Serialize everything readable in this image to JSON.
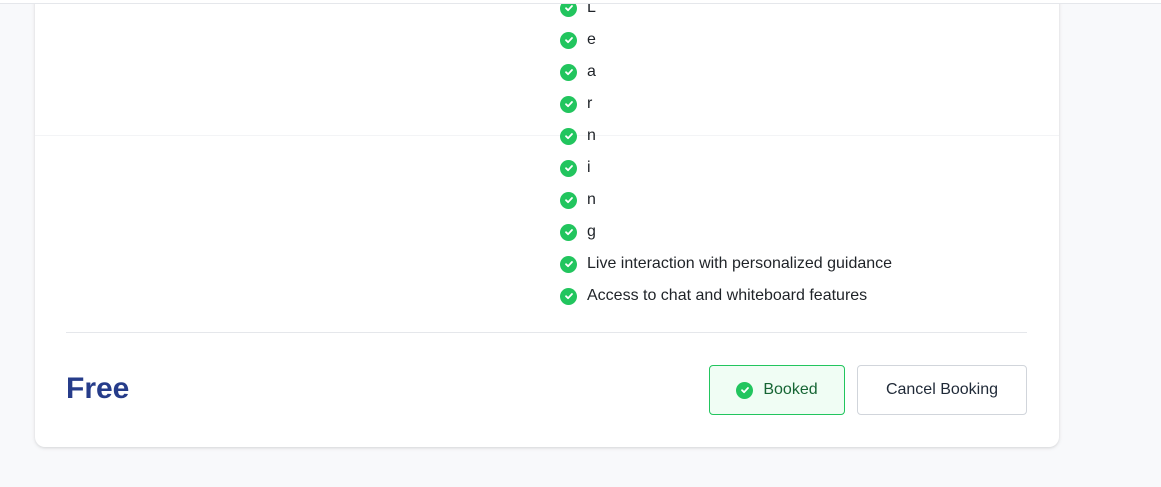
{
  "features": [
    "L",
    "e",
    "a",
    "r",
    "n",
    "i",
    "n",
    "g",
    "Live interaction with personalized guidance",
    "Access to chat and whiteboard features"
  ],
  "price": "Free",
  "actions": {
    "booked_label": "Booked",
    "cancel_label": "Cancel Booking"
  },
  "colors": {
    "accent_green": "#22c55e",
    "price_blue": "#263c8a"
  }
}
